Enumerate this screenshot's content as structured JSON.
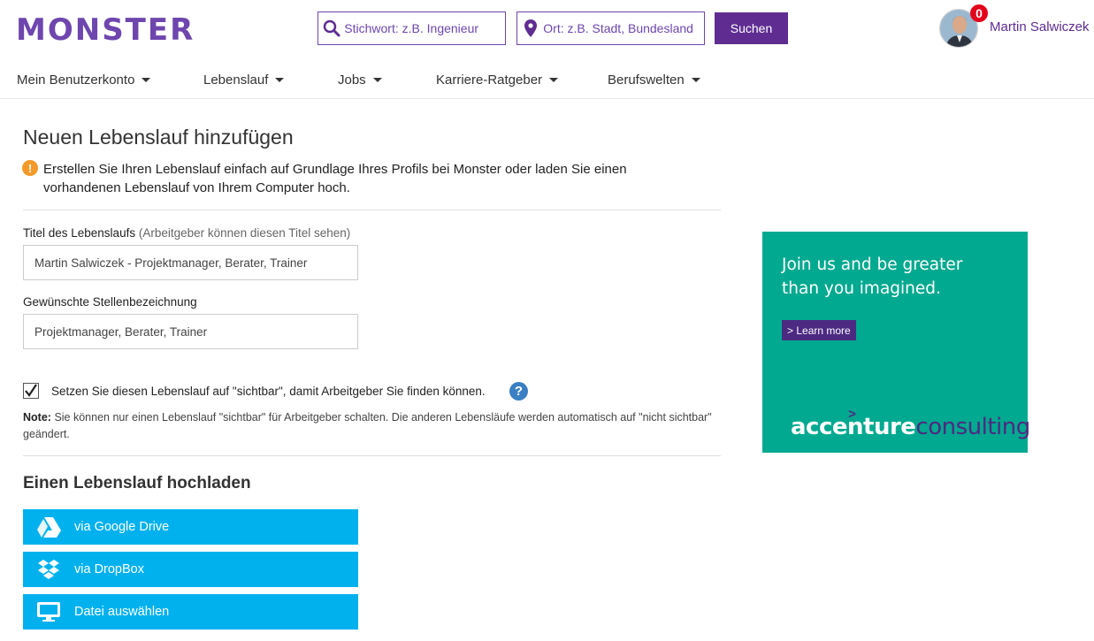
{
  "header": {
    "logo": "MONSTER",
    "keyword_placeholder": "Stichwort: z.B. Ingenieur",
    "location_placeholder": "Ort: z.B. Stadt, Bundesland",
    "search_label": "Suchen",
    "notifications": "0",
    "username": "Martin Salwiczek"
  },
  "nav": {
    "items": [
      {
        "label": "Mein Benutzerkonto"
      },
      {
        "label": "Lebenslauf"
      },
      {
        "label": "Jobs"
      },
      {
        "label": "Karriere-Ratgeber"
      },
      {
        "label": "Berufswelten"
      }
    ]
  },
  "main": {
    "title": "Neuen Lebenslauf hinzufügen",
    "info_text": "Erstellen Sie Ihren Lebenslauf einfach auf Grundlage Ihres Profils bei Monster oder laden Sie einen vorhandenen Lebenslauf von Ihrem Computer hoch.",
    "resume_title_label": "Titel des Lebenslaufs",
    "resume_title_hint": "(Arbeitgeber können diesen Titel sehen)",
    "resume_title_value": "Martin Salwiczek - Projektmanager, Berater, Trainer",
    "job_title_label": "Gewünschte Stellenbezeichnung",
    "job_title_value": "Projektmanager, Berater, Trainer",
    "visible_checked": true,
    "visible_label": "Setzen Sie diesen Lebenslauf auf \"sichtbar\", damit Arbeitgeber Sie finden können.",
    "note_label": "Note:",
    "note_text": "Sie können nur einen Lebenslauf \"sichtbar\" für Arbeitgeber schalten. Die anderen Lebensläufe werden automatisch auf \"nicht sichtbar\" geändert.",
    "upload_title": "Einen Lebenslauf hochladen",
    "upload_buttons": [
      {
        "label": "via Google Drive",
        "icon": "google-drive-icon"
      },
      {
        "label": "via DropBox",
        "icon": "dropbox-icon"
      },
      {
        "label": "Datei auswählen",
        "icon": "monitor-icon"
      }
    ]
  },
  "ad": {
    "headline_line1": "Join us and be greater",
    "headline_line2": "than you imagined.",
    "cta": "> Learn more",
    "brand_part1": "accenture",
    "brand_part2": "consulting",
    "brand_mark": ">"
  },
  "colors": {
    "brand_purple": "#6e46ae",
    "button_purple": "#5f2d91",
    "upload_blue": "#00b1ee",
    "ad_teal": "#00a98f",
    "badge_red": "#e2001a",
    "info_orange": "#f39a2b",
    "help_blue": "#3a7fc3"
  }
}
